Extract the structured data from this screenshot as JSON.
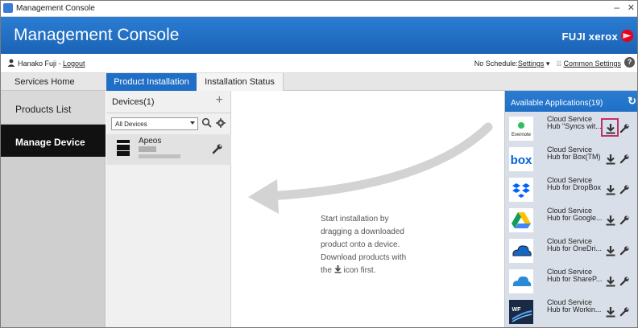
{
  "window": {
    "title": "Management Console"
  },
  "header": {
    "app_title": "Management Console",
    "brand": "FUJI xerox"
  },
  "userbar": {
    "user_name": "Hanako Fuji - ",
    "logout_label": "Logout",
    "schedule_label": "No Schedule:",
    "settings_label": "Settings",
    "common_settings_label": "Common Settings"
  },
  "tabs": {
    "home": "Services Home",
    "installation": "Product Installation",
    "status": "Installation Status"
  },
  "sidebar": {
    "items": [
      {
        "label": "Products List"
      },
      {
        "label": "Manage Device"
      }
    ]
  },
  "devices": {
    "title": "Devices(1)",
    "filter_value": "All Devices",
    "list": [
      {
        "name": "Apeos"
      }
    ]
  },
  "hint": {
    "line1": "Start installation by",
    "line2": "dragging a downloaded",
    "line3": "product onto a device.",
    "line4": "Download products with",
    "line5_a": "the ",
    "line5_b": " icon first."
  },
  "apps": {
    "title": "Available Applications(19)",
    "items": [
      {
        "name": "Cloud Service\nHub \"Syncs wit...",
        "logo_text": "Evernote",
        "icon": "evernote-logo-icon"
      },
      {
        "name": "Cloud Service\nHub for Box(TM)",
        "logo_text": "box",
        "icon": "box-logo-icon"
      },
      {
        "name": "Cloud Service\nHub for DropBox",
        "logo_text": "",
        "icon": "dropbox-logo-icon"
      },
      {
        "name": "Cloud Service\nHub for Google...",
        "logo_text": "",
        "icon": "google-drive-logo-icon"
      },
      {
        "name": "Cloud Service\nHub for OneDri...",
        "logo_text": "",
        "icon": "onedrive-logo-icon"
      },
      {
        "name": "Cloud Service\nHub for ShareP...",
        "logo_text": "",
        "icon": "sharepoint-logo-icon"
      },
      {
        "name": "Cloud Service\nHub for Workin...",
        "logo_text": "WF",
        "icon": "workflow-logo-icon"
      }
    ]
  },
  "colors": {
    "accent": "#1f6fc6",
    "nav_selected": "#111111",
    "highlight": "#c0306a"
  }
}
